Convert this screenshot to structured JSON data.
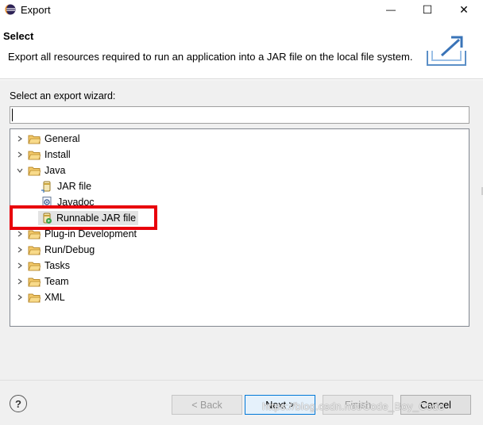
{
  "window": {
    "title": "Export",
    "minimize_glyph": "—",
    "maximize_glyph": "☐",
    "close_glyph": "✕"
  },
  "header": {
    "title": "Select",
    "description": "Export all resources required to run an application into a JAR file on the local file system."
  },
  "wizard": {
    "label": "Select an export wizard:",
    "filter_value": "",
    "tree": [
      {
        "label": "General",
        "expanded": false,
        "icon": "folder-icon"
      },
      {
        "label": "Install",
        "expanded": false,
        "icon": "folder-icon"
      },
      {
        "label": "Java",
        "expanded": true,
        "icon": "folder-icon",
        "children": [
          {
            "label": "JAR file",
            "icon": "jar-file-icon"
          },
          {
            "label": "Javadoc",
            "icon": "javadoc-icon"
          },
          {
            "label": "Runnable JAR file",
            "icon": "runnable-jar-icon",
            "selected": true
          }
        ]
      },
      {
        "label": "Plug-in Development",
        "expanded": false,
        "icon": "folder-icon"
      },
      {
        "label": "Run/Debug",
        "expanded": false,
        "icon": "folder-icon"
      },
      {
        "label": "Tasks",
        "expanded": false,
        "icon": "folder-icon"
      },
      {
        "label": "Team",
        "expanded": false,
        "icon": "folder-icon"
      },
      {
        "label": "XML",
        "expanded": false,
        "icon": "folder-icon"
      }
    ]
  },
  "footer": {
    "help_glyph": "?",
    "back_label": "< Back",
    "next_label": "Next >",
    "finish_label": "Finish",
    "cancel_label": "Cancel"
  },
  "watermark": "https://blog.csdn.net/Code_Boy_Code",
  "colors": {
    "highlight": "#e8000b",
    "folder": "#e8b94a",
    "default_button_border": "#0078d7"
  }
}
